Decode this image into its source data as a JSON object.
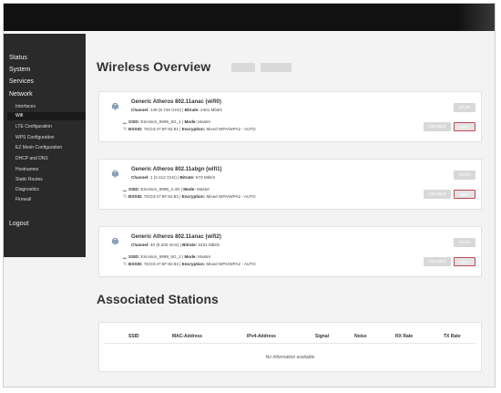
{
  "sidebar": {
    "categories": [
      "Status",
      "System",
      "Services",
      "Network"
    ],
    "network_items": [
      "Interfaces",
      "Wifi",
      "LTE Configuration",
      "WPS Configuration",
      "EZ Mesh Configuration",
      "DHCP and DNS",
      "Hostnames",
      "Static Routes",
      "Diagnostics",
      "Firewall"
    ],
    "active_item": "Wifi",
    "logout": "Logout"
  },
  "main": {
    "title": "Wireless Overview",
    "title_buttons": [
      "",
      ""
    ],
    "devices": [
      {
        "name": "Generic Atheros 802.11anac (wifi0)",
        "channel_label": "Channel:",
        "channel": "149 (5.745 GHz)",
        "bitrate_label": "Bitrate:",
        "bitrate": "2401 Mbit/s",
        "ssid_label": "SSID:",
        "ssid": "Ericsson_9999_5G_1",
        "mode_label": "Mode:",
        "mode": "Master",
        "bssid_label": "BSSID:",
        "bssid": "78:D3:47:6F:82:82",
        "encryption_label": "Encryption:",
        "encryption": "Mixed WPA/WPA2 - AUTO",
        "scan_label": "SCAN",
        "disable_label": "DISABLE",
        "edit_label": "EDIT"
      },
      {
        "name": "Generic Atheros 802.11abgn (wifi1)",
        "channel_label": "Channel:",
        "channel": "1 (2.412 GHz)",
        "bitrate_label": "Bitrate:",
        "bitrate": "573 Mbit/s",
        "ssid_label": "SSID:",
        "ssid": "Ericsson_9999_2.4G",
        "mode_label": "Mode:",
        "mode": "Master",
        "bssid_label": "BSSID:",
        "bssid": "78:D3:47:6F:82:83",
        "encryption_label": "Encryption:",
        "encryption": "Mixed WPA/WPA2 - AUTO",
        "scan_label": "SCAN",
        "disable_label": "DISABLE",
        "edit_label": "EDIT"
      },
      {
        "name": "Generic Atheros 802.11anac (wifi2)",
        "channel_label": "Channel:",
        "channel": "40 (5.200 GHz)",
        "bitrate_label": "Bitrate:",
        "bitrate": "2401 Mbit/s",
        "ssid_label": "SSID:",
        "ssid": "Ericsson_9999_5G_2",
        "mode_label": "Mode:",
        "mode": "Master",
        "bssid_label": "BSSID:",
        "bssid": "78:D3:47:6F:82:84",
        "encryption_label": "Encryption:",
        "encryption": "Mixed WPA/WPA2 - AUTO",
        "scan_label": "SCAN",
        "disable_label": "DISABLE",
        "edit_label": "EDIT"
      }
    ],
    "stations": {
      "title": "Associated Stations",
      "columns": [
        "SSID",
        "MAC-Address",
        "IPv4-Address",
        "Signal",
        "Noise",
        "RX Rate",
        "TX Rate"
      ],
      "empty_text": "No information available"
    }
  },
  "colors": {
    "sidebar_bg": "#2a2a2a",
    "topbar_bg": "#111111",
    "edit_border": "#c0474f",
    "button_bg": "#d8d8d8"
  }
}
